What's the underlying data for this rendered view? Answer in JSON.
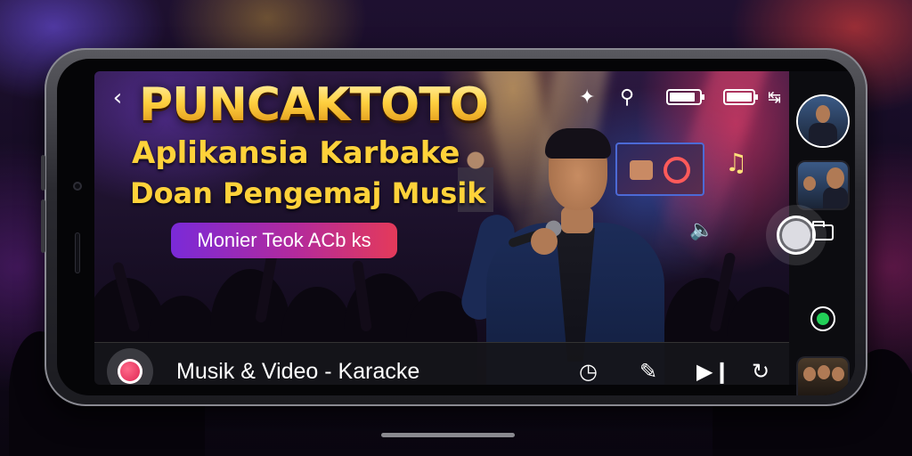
{
  "app": {
    "brand": "PUNCAKTOTO",
    "subtitle_line1": "Aplikansia Karbake",
    "subtitle_line2": "Doan Pengemaj Musik",
    "pill_label": "Monier Teok ACb ks"
  },
  "top_bar": {
    "icons": [
      "back-arrow-icon",
      "sparkle-icon",
      "search-icon",
      "battery-icon",
      "battery-status-icon"
    ]
  },
  "bottom_bar": {
    "title": "Musik & Video - Karacke",
    "icons": [
      "record-icon",
      "timer-icon",
      "edit-icon",
      "skip-next-icon",
      "refresh-icon"
    ]
  },
  "right_rail": {
    "items": [
      "profile-thumbnail",
      "video-thumbnail",
      "shutter-button",
      "folder-icon",
      "status-indicator",
      "group-thumbnail"
    ]
  },
  "colors": {
    "brand_gold": "#ffd040",
    "pill_start": "#7a2ad8",
    "pill_end": "#e43a5a",
    "record_red": "#d81848",
    "status_green": "#22d058"
  }
}
